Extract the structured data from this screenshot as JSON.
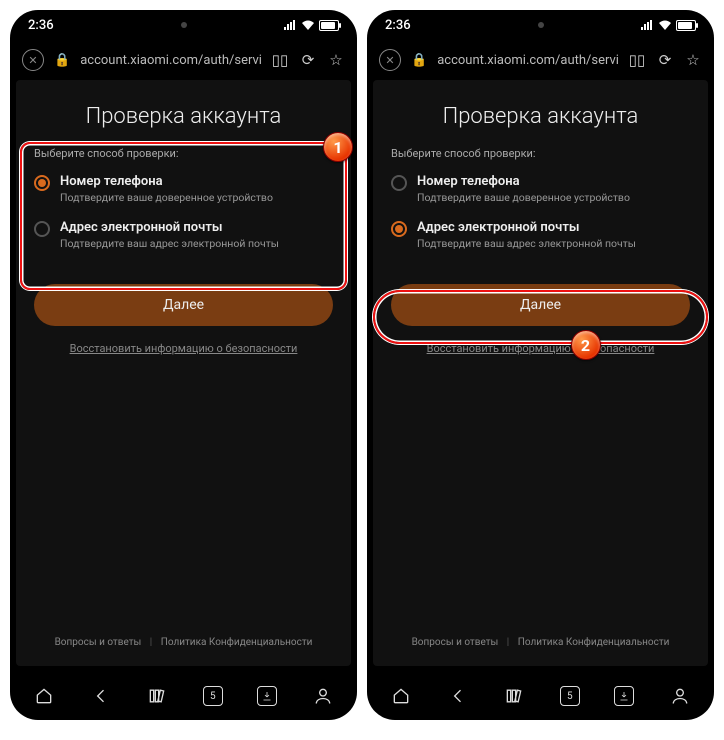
{
  "status": {
    "time": "2:36"
  },
  "browser": {
    "url": "account.xiaomi.com/auth/servi",
    "tab_count": "5"
  },
  "page": {
    "title": "Проверка аккаунта",
    "subtitle": "Выберите способ проверки:",
    "options": [
      {
        "label": "Номер телефона",
        "desc": "Подтвердите ваше доверенное устройство"
      },
      {
        "label": "Адрес электронной почты",
        "desc": "Подтвердите ваш адрес электронной почты"
      }
    ],
    "next": "Далее",
    "recover": "Восстановить информацию о безопасности",
    "faq": "Вопросы и ответы",
    "privacy": "Политика Конфиденциальности"
  },
  "callouts": {
    "one": "1",
    "two": "2"
  }
}
